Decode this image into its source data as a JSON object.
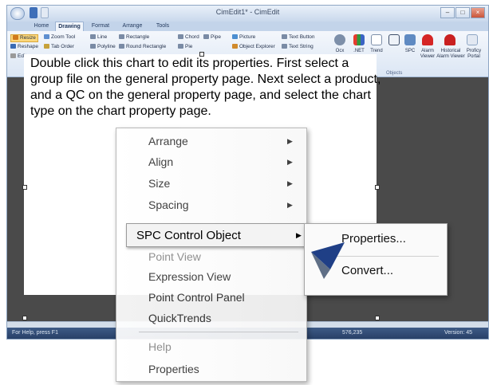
{
  "window": {
    "title": "CimEdit1* - CimEdit",
    "controls": [
      "–",
      "□",
      "×"
    ]
  },
  "tabs": [
    "Home",
    "Drawing",
    "Format",
    "Arrange",
    "Tools"
  ],
  "ribbon": {
    "left_col1": [
      "Resize",
      "Reshape",
      "Edit"
    ],
    "left_col2": [
      "Zoom Tool",
      "Tab Order"
    ],
    "shapes_col1": [
      "Line",
      "Polyline"
    ],
    "shapes_col2": [
      "Rectangle",
      "Round Rectangle"
    ],
    "shapes_col3": [
      "Chord",
      "Pie"
    ],
    "shapes_col4": [
      "Pipe"
    ],
    "insert_col1": [
      "Picture",
      "Object Explorer"
    ],
    "insert_col2": [
      "Text Button",
      "Text String"
    ],
    "objects": [
      "Ocx",
      ".NET",
      "Trend",
      "",
      "SPC",
      "Alarm Viewer",
      "Historical Alarm Viewer",
      "Proficy Portal"
    ],
    "group_label": "Objects"
  },
  "canvas": {
    "instructions": "Double click this chart to edit its properties. First select a group file on the general property page. Next select a product, and a QC on the general property page, and select the chart type on the chart property page."
  },
  "statusbar": {
    "help": "For Help, press F1",
    "middle": "576,235",
    "version": "Version: 45"
  },
  "context_menu": {
    "items": [
      "Arrange",
      "Align",
      "Size",
      "Spacing"
    ],
    "spc_item": "SPC Control Object",
    "lower_items": [
      "Point View",
      "Expression View",
      "Point Control Panel",
      "QuickTrends",
      "Help",
      "Properties"
    ]
  },
  "submenu": {
    "items": [
      "Properties...",
      "Convert..."
    ]
  }
}
